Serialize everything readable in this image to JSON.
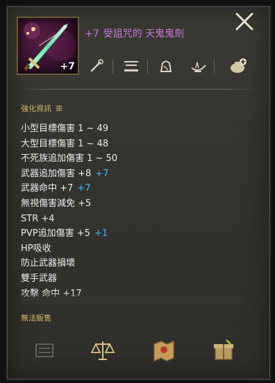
{
  "item": {
    "refine_badge": "+7",
    "title_refine": "+7",
    "title_name": "受詛咒的 天鬼鬼劍"
  },
  "icons": {
    "close": "close-icon",
    "tools": [
      "magnifier-wand-icon",
      "compare-equip-icon",
      "drop-bag-icon",
      "genie-lamp-icon",
      "add-bag-icon"
    ],
    "footer": [
      "disabled-settings-icon",
      "scale-icon",
      "treasure-map-icon",
      "gift-box-icon"
    ]
  },
  "section": {
    "title": "強化資訊"
  },
  "stats": [
    {
      "text": "小型目標傷害 1 ~ 49",
      "bonus": ""
    },
    {
      "text": "大型目標傷害 1 ~ 48",
      "bonus": ""
    },
    {
      "text": "不死族追加傷害 1 ~ 50",
      "bonus": ""
    },
    {
      "text": "武器追加傷害 +8",
      "bonus": "+7"
    },
    {
      "text": "武器命中 +7",
      "bonus": "+7"
    },
    {
      "text": "無視傷害減免 +5",
      "bonus": ""
    },
    {
      "text": "STR +4",
      "bonus": ""
    },
    {
      "text": "PVP追加傷害 +5",
      "bonus": "+1"
    },
    {
      "text": "HP吸收",
      "bonus": ""
    },
    {
      "text": "防止武器損壞",
      "bonus": ""
    },
    {
      "text": "雙手武器",
      "bonus": ""
    },
    {
      "text": "攻擊 命中 +17",
      "bonus": ""
    }
  ],
  "footer": {
    "no_sale": "無法販售"
  },
  "colors": {
    "title": "#c77bd8",
    "bonus": "#45b6e8",
    "section": "#d4b96a"
  }
}
